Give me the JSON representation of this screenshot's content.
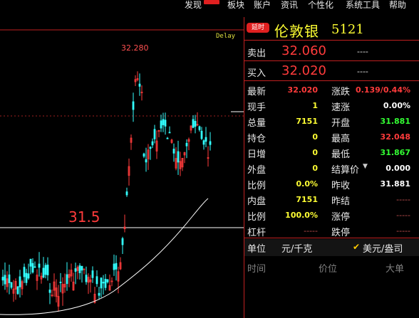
{
  "menu": {
    "items": [
      "发现",
      "板块",
      "账户",
      "资讯",
      "个性化",
      "系统工具",
      "帮助"
    ]
  },
  "chart": {
    "delay": "Delay",
    "high_label": "32.280",
    "level_label": "31.5",
    "colors": {
      "up": "#ff3b3b",
      "down": "#33ffff",
      "ma": "#ffffff"
    }
  },
  "quote": {
    "delay_tag": "延时",
    "name": "伦敦银",
    "code": "5121",
    "sell_label": "卖出",
    "sell_price": "32.060",
    "sell_vol": "----",
    "buy_label": "买入",
    "buy_price": "32.020",
    "buy_vol": "----",
    "left": [
      {
        "label": "最新",
        "value": "32.020",
        "color": "red"
      },
      {
        "label": "现手",
        "value": "1",
        "color": "yellow"
      },
      {
        "label": "总量",
        "value": "7151",
        "color": "yellow"
      },
      {
        "label": "持仓",
        "value": "0",
        "color": "yellow"
      },
      {
        "label": "日增",
        "value": "0",
        "color": "yellow"
      },
      {
        "label": "外盘",
        "value": "0",
        "color": "yellow"
      },
      {
        "label": "比例",
        "value": "0.0%",
        "color": "yellow"
      },
      {
        "label": "内盘",
        "value": "7151",
        "color": "yellow"
      },
      {
        "label": "比例",
        "value": "100.0%",
        "color": "yellow"
      },
      {
        "label": "杠杆",
        "value": "-----",
        "color": "dash"
      }
    ],
    "right": [
      {
        "label": "涨跌",
        "value": "0.139/0.44%",
        "color": "red"
      },
      {
        "label": "速涨",
        "value": "0.00%",
        "color": "white"
      },
      {
        "label": "开盘",
        "value": "31.881",
        "color": "green"
      },
      {
        "label": "最高",
        "value": "32.048",
        "color": "red"
      },
      {
        "label": "最低",
        "value": "31.867",
        "color": "green"
      },
      {
        "label": "结算价",
        "value": "0.000",
        "color": "white"
      },
      {
        "label": "昨收",
        "value": "31.881",
        "color": "white"
      },
      {
        "label": "昨结",
        "value": "-----",
        "color": "dash"
      },
      {
        "label": "涨停",
        "value": "-----",
        "color": "dash"
      },
      {
        "label": "跌停",
        "value": "-----",
        "color": "dash"
      }
    ],
    "unit_label": "单位",
    "unit_value": "元/千克",
    "unit_alt": "美元/盎司",
    "trades_header": [
      "时间",
      "价位",
      "大单"
    ]
  }
}
